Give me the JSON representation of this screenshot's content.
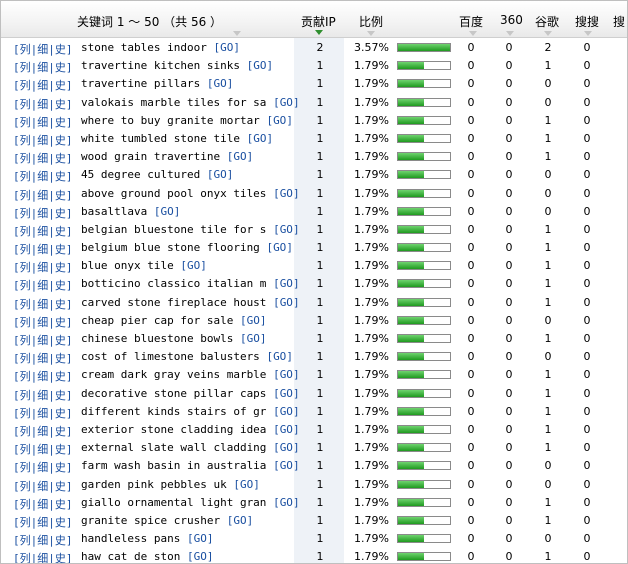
{
  "header": {
    "keyword_label": "关键词 1 ～ 50 （共 56 ）",
    "ip_label": "贡献IP",
    "ratio_label": "比例",
    "baidu_label": "百度",
    "s360_label": "360",
    "google_label": "谷歌",
    "sougou_label": "搜搜",
    "extra_label": "搜"
  },
  "row_links": {
    "lie": "列",
    "xi": "细",
    "shi": "史"
  },
  "go_label": "GO",
  "bar_color": "#2ea82e",
  "rows": [
    {
      "kw": "stone tables indoor",
      "ip": "2",
      "ratio": "3.57%",
      "fill": 1.0,
      "baidu": "0",
      "s360": "0",
      "google": "2",
      "sougou": "0"
    },
    {
      "kw": "travertine kitchen sinks",
      "ip": "1",
      "ratio": "1.79%",
      "fill": 0.5,
      "baidu": "0",
      "s360": "0",
      "google": "1",
      "sougou": "0"
    },
    {
      "kw": "travertine pillars",
      "ip": "1",
      "ratio": "1.79%",
      "fill": 0.5,
      "baidu": "0",
      "s360": "0",
      "google": "0",
      "sougou": "0"
    },
    {
      "kw": "valokais marble tiles for sa",
      "ip": "1",
      "ratio": "1.79%",
      "fill": 0.5,
      "baidu": "0",
      "s360": "0",
      "google": "0",
      "sougou": "0"
    },
    {
      "kw": "where to buy granite mortar",
      "ip": "1",
      "ratio": "1.79%",
      "fill": 0.5,
      "baidu": "0",
      "s360": "0",
      "google": "1",
      "sougou": "0"
    },
    {
      "kw": "white tumbled stone tile",
      "ip": "1",
      "ratio": "1.79%",
      "fill": 0.5,
      "baidu": "0",
      "s360": "0",
      "google": "1",
      "sougou": "0"
    },
    {
      "kw": "wood grain travertine",
      "ip": "1",
      "ratio": "1.79%",
      "fill": 0.5,
      "baidu": "0",
      "s360": "0",
      "google": "1",
      "sougou": "0"
    },
    {
      "kw": "45 degree cultured",
      "ip": "1",
      "ratio": "1.79%",
      "fill": 0.5,
      "baidu": "0",
      "s360": "0",
      "google": "0",
      "sougou": "0"
    },
    {
      "kw": "above ground pool onyx tiles",
      "ip": "1",
      "ratio": "1.79%",
      "fill": 0.5,
      "baidu": "0",
      "s360": "0",
      "google": "0",
      "sougou": "0"
    },
    {
      "kw": "basaltlava",
      "ip": "1",
      "ratio": "1.79%",
      "fill": 0.5,
      "baidu": "0",
      "s360": "0",
      "google": "0",
      "sougou": "0"
    },
    {
      "kw": "belgian bluestone tile for s",
      "ip": "1",
      "ratio": "1.79%",
      "fill": 0.5,
      "baidu": "0",
      "s360": "0",
      "google": "1",
      "sougou": "0"
    },
    {
      "kw": "belgium blue stone flooring",
      "ip": "1",
      "ratio": "1.79%",
      "fill": 0.5,
      "baidu": "0",
      "s360": "0",
      "google": "1",
      "sougou": "0"
    },
    {
      "kw": "blue onyx tile",
      "ip": "1",
      "ratio": "1.79%",
      "fill": 0.5,
      "baidu": "0",
      "s360": "0",
      "google": "1",
      "sougou": "0"
    },
    {
      "kw": "botticino classico italian m",
      "ip": "1",
      "ratio": "1.79%",
      "fill": 0.5,
      "baidu": "0",
      "s360": "0",
      "google": "1",
      "sougou": "0"
    },
    {
      "kw": "carved stone fireplace houst",
      "ip": "1",
      "ratio": "1.79%",
      "fill": 0.5,
      "baidu": "0",
      "s360": "0",
      "google": "1",
      "sougou": "0"
    },
    {
      "kw": "cheap pier cap for sale",
      "ip": "1",
      "ratio": "1.79%",
      "fill": 0.5,
      "baidu": "0",
      "s360": "0",
      "google": "0",
      "sougou": "0"
    },
    {
      "kw": "chinese bluestone bowls",
      "ip": "1",
      "ratio": "1.79%",
      "fill": 0.5,
      "baidu": "0",
      "s360": "0",
      "google": "1",
      "sougou": "0"
    },
    {
      "kw": "cost of limestone balusters",
      "ip": "1",
      "ratio": "1.79%",
      "fill": 0.5,
      "baidu": "0",
      "s360": "0",
      "google": "0",
      "sougou": "0"
    },
    {
      "kw": "cream dark gray veins marble",
      "ip": "1",
      "ratio": "1.79%",
      "fill": 0.5,
      "baidu": "0",
      "s360": "0",
      "google": "1",
      "sougou": "0"
    },
    {
      "kw": "decorative stone pillar caps",
      "ip": "1",
      "ratio": "1.79%",
      "fill": 0.5,
      "baidu": "0",
      "s360": "0",
      "google": "1",
      "sougou": "0"
    },
    {
      "kw": "different kinds stairs of gr",
      "ip": "1",
      "ratio": "1.79%",
      "fill": 0.5,
      "baidu": "0",
      "s360": "0",
      "google": "1",
      "sougou": "0"
    },
    {
      "kw": "exterior stone cladding idea",
      "ip": "1",
      "ratio": "1.79%",
      "fill": 0.5,
      "baidu": "0",
      "s360": "0",
      "google": "1",
      "sougou": "0"
    },
    {
      "kw": "external slate wall cladding",
      "ip": "1",
      "ratio": "1.79%",
      "fill": 0.5,
      "baidu": "0",
      "s360": "0",
      "google": "1",
      "sougou": "0"
    },
    {
      "kw": "farm wash basin in australia",
      "ip": "1",
      "ratio": "1.79%",
      "fill": 0.5,
      "baidu": "0",
      "s360": "0",
      "google": "0",
      "sougou": "0"
    },
    {
      "kw": "garden pink pebbles uk",
      "ip": "1",
      "ratio": "1.79%",
      "fill": 0.5,
      "baidu": "0",
      "s360": "0",
      "google": "0",
      "sougou": "0"
    },
    {
      "kw": "giallo ornamental light gran",
      "ip": "1",
      "ratio": "1.79%",
      "fill": 0.5,
      "baidu": "0",
      "s360": "0",
      "google": "1",
      "sougou": "0"
    },
    {
      "kw": "granite spice crusher",
      "ip": "1",
      "ratio": "1.79%",
      "fill": 0.5,
      "baidu": "0",
      "s360": "0",
      "google": "1",
      "sougou": "0"
    },
    {
      "kw": "handleless pans",
      "ip": "1",
      "ratio": "1.79%",
      "fill": 0.5,
      "baidu": "0",
      "s360": "0",
      "google": "0",
      "sougou": "0"
    },
    {
      "kw": "haw cat de ston",
      "ip": "1",
      "ratio": "1.79%",
      "fill": 0.5,
      "baidu": "0",
      "s360": "0",
      "google": "1",
      "sougou": "0"
    }
  ]
}
